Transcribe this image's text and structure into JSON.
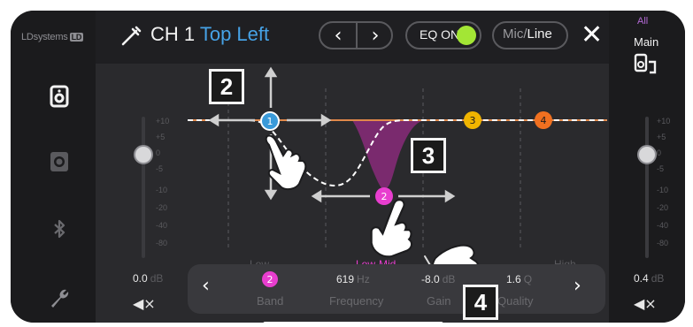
{
  "app": {
    "brand": "LDsystems",
    "brand_badge": "LD"
  },
  "header": {
    "channel_prefix": "CH 1",
    "channel_name": "Top Left",
    "eq_label": "EQ ON",
    "eq_on": true,
    "source_inactive": "Mic/",
    "source_active": "Line"
  },
  "sidebar": {
    "items": [
      {
        "name": "monitor-speaker-icon"
      },
      {
        "name": "main-speaker-icon"
      },
      {
        "name": "bluetooth-icon"
      },
      {
        "name": "settings-wrench-icon"
      }
    ]
  },
  "fader_scale": [
    "+10",
    "+5",
    "0",
    "-5",
    "-10",
    "-20",
    "-40",
    "-80"
  ],
  "band_regions": [
    "Low",
    "Low-Mid",
    "High"
  ],
  "bands": [
    {
      "number": "1",
      "color": "#3a9ad9"
    },
    {
      "number": "2",
      "color": "#e83ecf"
    },
    {
      "number": "3",
      "color": "#f0b400"
    },
    {
      "number": "4",
      "color": "#f07020"
    }
  ],
  "left_volume": {
    "value": "0.0",
    "unit": "dB"
  },
  "params": {
    "band_number": "2",
    "band_label": "Band",
    "frequency_value": "619",
    "frequency_unit": "Hz",
    "frequency_label": "Frequency",
    "gain_value": "-8.0",
    "gain_unit": "dB",
    "gain_label": "Gain",
    "quality_value": "1.6",
    "quality_unit": "Q",
    "quality_label": "Quality"
  },
  "right_panel": {
    "all_label": "All",
    "main_label": "Main",
    "volume": "0.4",
    "unit": "dB"
  },
  "callouts": [
    "2",
    "3",
    "4"
  ],
  "colors": {
    "accent": "#46a2e6",
    "eq_toggle": "#a3e635",
    "band2": "#e83ecf",
    "fill": "#7a2a6e"
  }
}
